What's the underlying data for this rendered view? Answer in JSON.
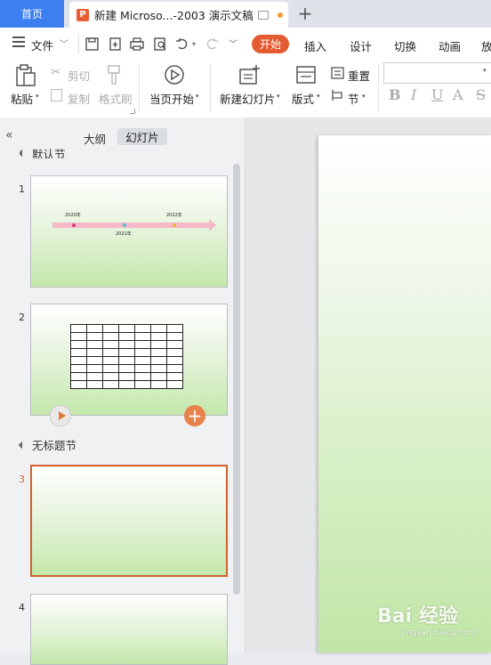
{
  "tabs": {
    "home": "首页",
    "document_title": "新建 Microso...-2003 演示文稿",
    "add": "+"
  },
  "menu": {
    "file": "文件",
    "items": [
      "开始",
      "插入",
      "设计",
      "切换",
      "动画",
      "放"
    ]
  },
  "ribbon": {
    "paste": "粘贴",
    "cut": "剪切",
    "copy": "复制",
    "format_painter": "格式刷",
    "from_current": "当页开始",
    "new_slide": "新建幻灯片",
    "layout": "版式",
    "reset": "重置",
    "section": "节",
    "format_buttons": [
      "B",
      "I",
      "U",
      "A",
      "S"
    ]
  },
  "left_panel": {
    "tab_outline": "大纲",
    "tab_slides": "幻灯片",
    "section_default": "默认节",
    "section_untitled": "无标题节",
    "slide_numbers": [
      "1",
      "2",
      "3",
      "4"
    ]
  },
  "slide1": {
    "labels": [
      "2020年",
      "2021年",
      "2022年"
    ]
  },
  "slide2": {
    "rows": 8,
    "cols": 7
  },
  "watermark": {
    "brand": "Bai 经验",
    "url": "jingyan.baidu.com"
  },
  "colors": {
    "accent": "#e45b31",
    "home_tab": "#3d7ef0",
    "selected_border": "#d2622f"
  }
}
